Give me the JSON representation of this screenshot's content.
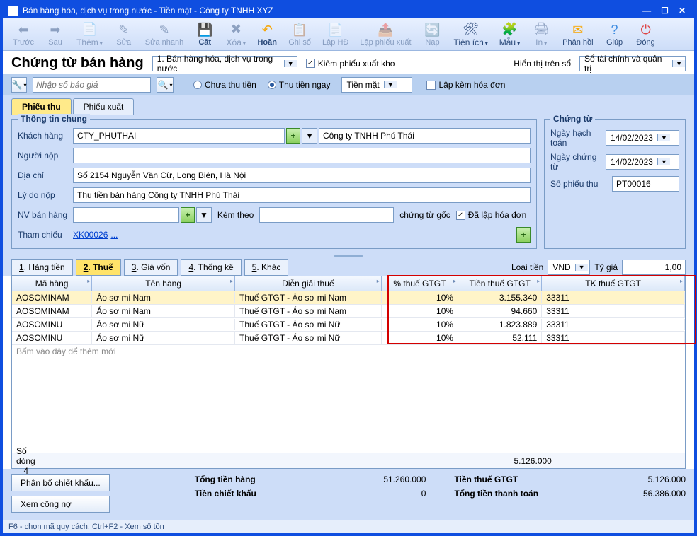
{
  "window": {
    "title": "Bán hàng hóa, dịch vụ trong nước - Tiền mặt - Công ty TNHH XYZ"
  },
  "toolbar": {
    "truoc": "Trước",
    "sau": "Sau",
    "them": "Thêm",
    "sua": "Sửa",
    "suanhanh": "Sửa nhanh",
    "cat": "Cất",
    "xoa": "Xóa",
    "hoan": "Hoãn",
    "ghiso": "Ghi sổ",
    "laphd": "Lập HĐ",
    "lapphieu": "Lập phiếu xuất",
    "nap": "Nạp",
    "tienich": "Tiện ích",
    "mau": "Mẫu",
    "in": "In",
    "phanhoi": "Phản hồi",
    "giup": "Giúp",
    "dong": "Đóng"
  },
  "title_row": {
    "page_title": "Chứng từ bán hàng",
    "type_dropdown": "1. Bán hàng hóa, dịch vụ trong nước",
    "kiem_label": "Kiêm phiếu xuất kho",
    "display_label": "Hiển thị trên sổ",
    "display_value": "Sổ tài chính và quản trị"
  },
  "search_row": {
    "placeholder": "Nhập số báo giá",
    "radio1": "Chưa thu tiền",
    "radio2": "Thu tiền ngay",
    "pay_method": "Tiền mặt",
    "lapkem": "Lập kèm hóa đơn"
  },
  "tabs": {
    "tab1": "Phiếu thu",
    "tab2": "Phiếu xuất"
  },
  "general": {
    "legend": "Thông tin chung",
    "kh_label": "Khách hàng",
    "kh_code": "CTY_PHUTHAI",
    "kh_name": "Công ty TNHH Phú Thái",
    "nguoinop": "Người nộp",
    "diachi_label": "Địa chỉ",
    "diachi_val": "Số 2154 Nguyễn Văn Cừ, Long Biên, Hà Nội",
    "lydo_label": "Lý do nộp",
    "lydo_val": "Thu tiền bán hàng Công ty TNHH Phú Thái",
    "nvbh_label": "NV bán hàng",
    "kemtheo": "Kèm theo",
    "chungtugoc": "chứng từ gốc",
    "dalaphd": "Đã lập hóa đơn",
    "thamchieu": "Tham chiếu",
    "thamchieu_val": "XK00026",
    "tc_more": "..."
  },
  "doc": {
    "legend": "Chứng từ",
    "hachtoan_label": "Ngày hạch toán",
    "hachtoan_val": "14/02/2023",
    "chungtu_label": "Ngày chứng từ",
    "chungtu_val": "14/02/2023",
    "sophieu_label": "Số phiếu thu",
    "sophieu_val": "PT00016"
  },
  "mini_tabs": {
    "t1_u": "1",
    "t1_r": ". Hàng tiền",
    "t2_u": "2",
    "t2_r": ". Thuế",
    "t3_u": "3",
    "t3_r": ". Giá vốn",
    "t4_u": "4",
    "t4_r": ". Thống kê",
    "t5_u": "5",
    "t5_r": ". Khác",
    "loaitien": "Loại tiền",
    "currency": "VND",
    "tygia": "Tỷ giá",
    "rate": "1,00"
  },
  "grid": {
    "headers": {
      "ma": "Mã hàng",
      "ten": "Tên hàng",
      "dien": "Diễn giải thuế",
      "pthue": "% thuế GTGT",
      "tienthue": "Tiền thuế GTGT",
      "tk": "TK thuế GTGT"
    },
    "rows": [
      {
        "ma": "AOSOMINAM",
        "ten": "Áo sơ mi Nam",
        "dien": "Thuế GTGT - Áo sơ mi Nam",
        "pthue": "10%",
        "tien": "3.155.340",
        "tk": "33311"
      },
      {
        "ma": "AOSOMINAM",
        "ten": "Áo sơ mi Nam",
        "dien": "Thuế GTGT - Áo sơ mi Nam",
        "pthue": "10%",
        "tien": "94.660",
        "tk": "33311"
      },
      {
        "ma": "AOSOMINU",
        "ten": "Áo sơ mi Nữ",
        "dien": "Thuế GTGT - Áo sơ mi Nữ",
        "pthue": "10%",
        "tien": "1.823.889",
        "tk": "33311"
      },
      {
        "ma": "AOSOMINU",
        "ten": "Áo sơ mi Nữ",
        "dien": "Thuế GTGT - Áo sơ mi Nữ",
        "pthue": "10%",
        "tien": "52.111",
        "tk": "33311"
      }
    ],
    "new_row": "Bấm vào đây để thêm mới",
    "footer_left": "Số dòng = 4",
    "footer_sum": "5.126.000"
  },
  "totals": {
    "btn_phanbo": "Phân bổ chiết khấu...",
    "btn_congno": "Xem công nợ",
    "tongtienhang_l": "Tổng tiền hàng",
    "tongtienhang_v": "51.260.000",
    "chietkhau_l": "Tiền chiết khấu",
    "chietkhau_v": "0",
    "thuegtgt_l": "Tiền thuế GTGT",
    "thuegtgt_v": "5.126.000",
    "thanhtoan_l": "Tổng tiền thanh toán",
    "thanhtoan_v": "56.386.000"
  },
  "status": "F6 - chọn mã quy cách, Ctrl+F2 - Xem số tồn"
}
